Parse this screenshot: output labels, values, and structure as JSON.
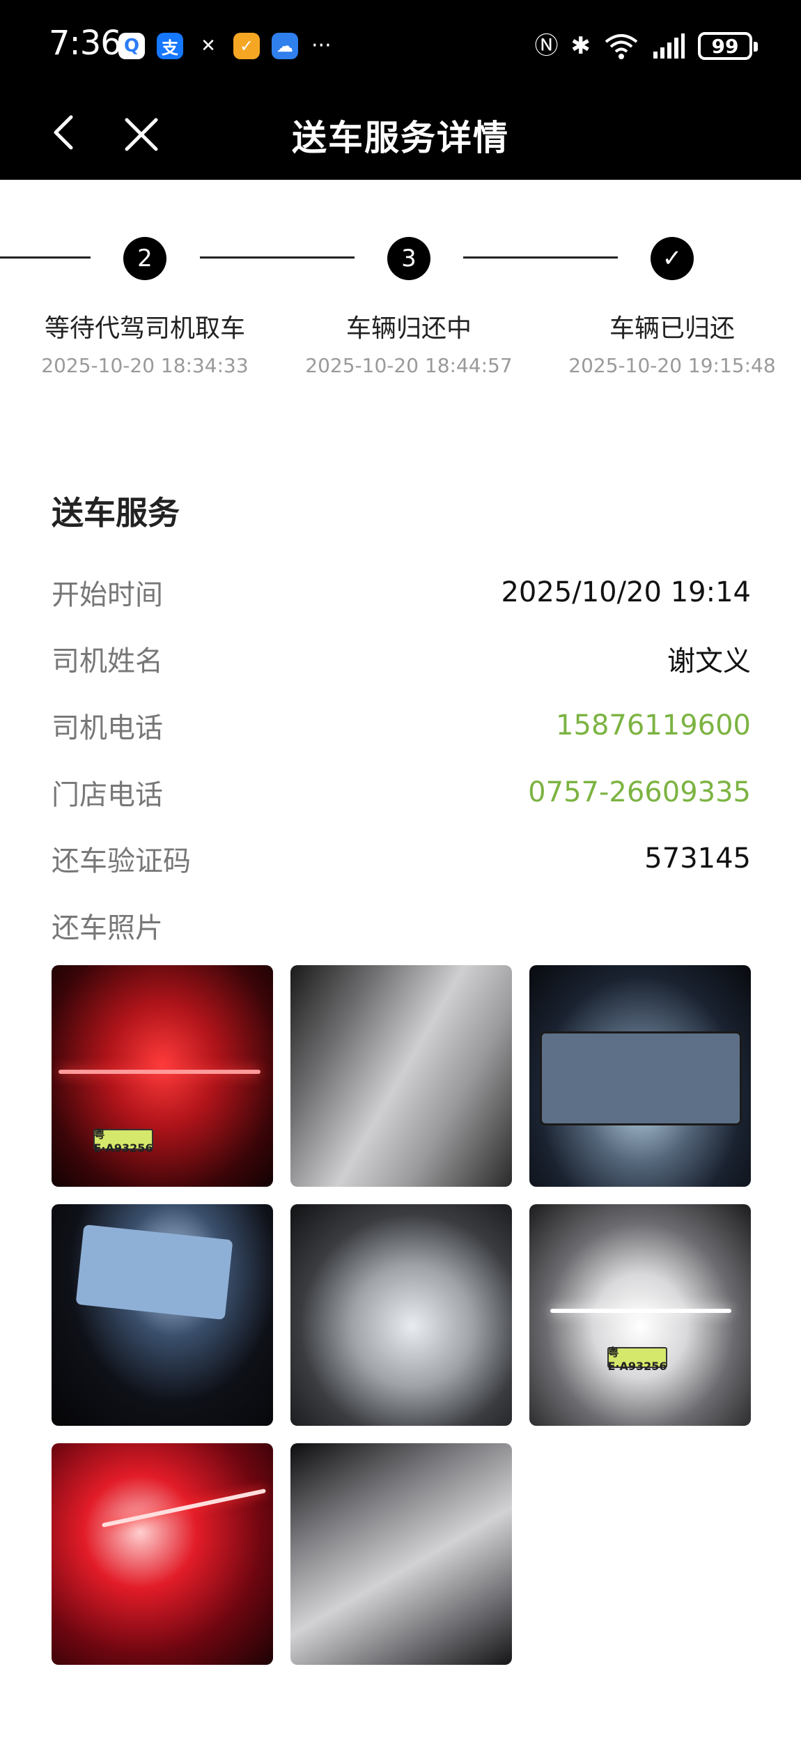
{
  "status_bar": {
    "time": "7:36",
    "battery": "99",
    "app_icons": [
      "qq-browser-icon",
      "alipay-icon",
      "dida-icon",
      "taobao-flash-icon",
      "weather-icon"
    ],
    "more": "···"
  },
  "nav": {
    "title": "送车服务详情"
  },
  "progress": {
    "steps": [
      {
        "marker": "2",
        "label": "等待代驾司机取车",
        "time": "2025-10-20 18:34:33"
      },
      {
        "marker": "3",
        "label": "车辆归还中",
        "time": "2025-10-20 18:44:57"
      },
      {
        "marker": "✓",
        "label": "车辆已归还",
        "time": "2025-10-20 19:15:48"
      }
    ]
  },
  "service": {
    "title": "送车服务",
    "rows": [
      {
        "label": "开始时间",
        "value": "2025/10/20 19:14"
      },
      {
        "label": "司机姓名",
        "value": "谢文义"
      },
      {
        "label": "司机电话",
        "value": "15876119600"
      },
      {
        "label": "门店电话",
        "value": "0757-26609335"
      },
      {
        "label": "还车验证码",
        "value": "573145"
      }
    ],
    "photos_label": "还车照片",
    "plates": [
      "粤E·A93256",
      "粤E·A93256"
    ]
  },
  "colors": {
    "link": "#7cb342",
    "header_bg": "#000000"
  }
}
